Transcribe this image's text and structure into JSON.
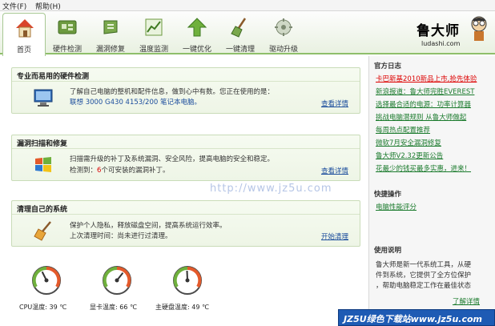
{
  "menu": {
    "file": "文件(F)",
    "help": "帮助(H)"
  },
  "toolbar": {
    "items": [
      {
        "label": "首页",
        "icon": "home-icon"
      },
      {
        "label": "硬件检测",
        "icon": "hardware-icon"
      },
      {
        "label": "漏洞修复",
        "icon": "patch-icon"
      },
      {
        "label": "温度监测",
        "icon": "temperature-icon"
      },
      {
        "label": "一键优化",
        "icon": "optimize-icon"
      },
      {
        "label": "一键清理",
        "icon": "broom-icon"
      },
      {
        "label": "驱动升级",
        "icon": "driver-icon"
      }
    ]
  },
  "logo": {
    "name": "鲁大师",
    "url": "ludashi.com"
  },
  "panels": {
    "hardware": {
      "title": "专业而易用的硬件检测",
      "line1": "了解自己电脑的整机和配件信息，做到心中有数。您正在使用的是：",
      "line2": "联想 3000 G430 4153/200 笔记本电脑。",
      "link": "查看详情"
    },
    "vuln": {
      "title": "漏洞扫描和修复",
      "line1": "扫描需升级的补丁及系统漏洞、安全风险，提高电脑的安全和稳定。",
      "line2_prefix": "检测到：",
      "count": "6",
      "line2_suffix": "个可安装的漏洞补丁。",
      "link": "查看详情"
    },
    "clean": {
      "title": "清理自己的系统",
      "line1": "保护个人隐私，释放磁盘空间，提高系统运行效率。",
      "line2": "上次清理时间：尚未进行过清理。",
      "link": "开始清理"
    }
  },
  "temps": [
    {
      "label": "CPU温度: 39 ℃",
      "value": 39
    },
    {
      "label": "显卡温度: 66 ℃",
      "value": 66
    },
    {
      "label": "主硬盘温度: 49 ℃",
      "value": 49
    }
  ],
  "sidebar": {
    "news_title": "官方日志",
    "news": [
      "卡巴新基2010新品上市,抢先体验",
      "新浪报道：鲁大师完胜EVEREST",
      "选择最合适的电源：功率计算器",
      "挑战电脑潜规则 从鲁大师做起",
      "每周热点配置推荐",
      "微软7月安全漏洞修复",
      "鲁大师V2.32更新公告",
      "花最少的钱买最多实惠，进来！"
    ],
    "quick_title": "快捷操作",
    "quick_link": "电脑性能评分",
    "help_title": "使用说明",
    "help_lines": [
      "鲁大师是新一代系统工具，从硬",
      "件到系统，它提供了全方位保护",
      "，帮助电脑稳定工作在最佳状态"
    ],
    "help_link": "了解详情"
  },
  "watermark": "http://www.jz5u.com",
  "banner": "JZ5U绿色下载站www.jz5u.com",
  "colors": {
    "accent_green": "#8fbf6a",
    "link_blue": "#1a4c9c",
    "alert_red": "#dd0000"
  }
}
